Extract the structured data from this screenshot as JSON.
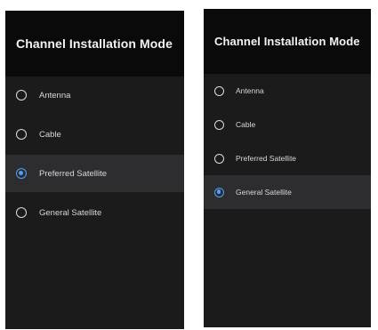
{
  "screens": [
    {
      "title": "Channel Installation Mode",
      "options": [
        {
          "label": "Antenna",
          "selected": false
        },
        {
          "label": "Cable",
          "selected": false
        },
        {
          "label": "Preferred Satellite",
          "selected": true
        },
        {
          "label": "General Satellite",
          "selected": false
        }
      ]
    },
    {
      "title": "Channel Installation Mode",
      "options": [
        {
          "label": "Antenna",
          "selected": false
        },
        {
          "label": "Cable",
          "selected": false
        },
        {
          "label": "Preferred Satellite",
          "selected": false
        },
        {
          "label": "General Satellite",
          "selected": true
        }
      ]
    }
  ],
  "colors": {
    "panel_background": "#1b1b1b",
    "header_background": "#0a0a0a",
    "highlight_row": "#2d2d30",
    "accent": "#4f9ef7"
  },
  "icons": {
    "radio_unselected": "radio-empty-icon",
    "radio_selected": "radio-selected-icon"
  }
}
